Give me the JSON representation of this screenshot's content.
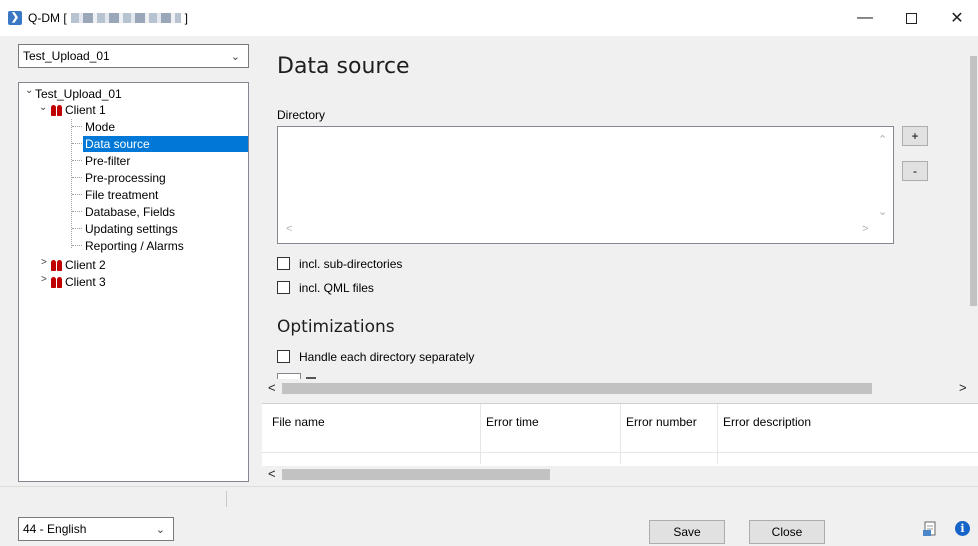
{
  "window": {
    "title_prefix": "Q-DM [",
    "title_suffix": "]",
    "app_icon": "app-icon",
    "minimize": "—",
    "maximize": "",
    "close": "✕"
  },
  "project_select": {
    "value": "Test_Upload_01"
  },
  "tree": {
    "root": "Test_Upload_01",
    "client1": "Client 1",
    "client1_children": [
      "Mode",
      "Data source",
      "Pre-filter",
      "Pre-processing",
      "File treatment",
      "Database, Fields",
      "Updating settings",
      "Reporting / Alarms"
    ],
    "client2": "Client 2",
    "client3": "Client 3",
    "selected": "Data source"
  },
  "main": {
    "title": "Data source",
    "directory_label": "Directory",
    "add_button": "+",
    "remove_button": "-",
    "incl_subdirs_label": "incl. sub-directories",
    "incl_qml_label": "incl. QML files",
    "optimizations_title": "Optimizations",
    "handle_each_dir_label": "Handle each directory separately"
  },
  "error_grid": {
    "columns": [
      "File name",
      "Error time",
      "Error number",
      "Error description"
    ]
  },
  "footer": {
    "language_select": "44 - English",
    "save_label": "Save",
    "close_label": "Close"
  },
  "colors": {
    "selection": "#0078d7",
    "client_icon": "#c00000",
    "info_icon": "#1664c8"
  }
}
